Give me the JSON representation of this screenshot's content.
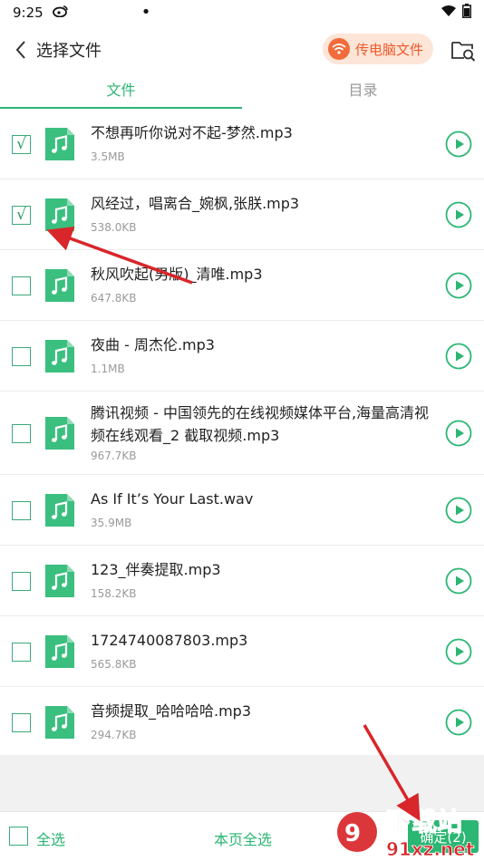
{
  "status_bar": {
    "time": "9:25"
  },
  "header": {
    "title": "选择文件",
    "pc_transfer_label": "传电脑文件"
  },
  "tabs": [
    {
      "label": "文件"
    },
    {
      "label": "目录"
    }
  ],
  "files": [
    {
      "name": "不想再听你说对不起-梦然.mp3",
      "size": "3.5MB",
      "checked": true
    },
    {
      "name": "风经过，唱离合_婉枫,张朕.mp3",
      "size": "538.0KB",
      "checked": true
    },
    {
      "name": "秋风吹起(男版)_清唯.mp3",
      "size": "647.8KB",
      "checked": false
    },
    {
      "name": "夜曲 - 周杰伦.mp3",
      "size": "1.1MB",
      "checked": false
    },
    {
      "name": "腾讯视频 - 中国领先的在线视频媒体平台,海量高清视频在线观看_2 截取视频.mp3",
      "size": "967.7KB",
      "checked": false
    },
    {
      "name": "As If It’s Your Last.wav",
      "size": "35.9MB",
      "checked": false
    },
    {
      "name": "123_伴奏提取.mp3",
      "size": "158.2KB",
      "checked": false
    },
    {
      "name": "1724740087803.mp3",
      "size": "565.8KB",
      "checked": false
    },
    {
      "name": "音频提取_哈哈哈哈.mp3",
      "size": "294.7KB",
      "checked": false
    }
  ],
  "bottom": {
    "select_all": "全选",
    "select_page": "本页全选",
    "confirm": "确定(2)"
  },
  "watermark": {
    "text": "下载站",
    "site": "91xz.net"
  },
  "colors": {
    "accent": "#2bb673",
    "orange": "#f26b3a",
    "arrow": "#d8262a"
  }
}
